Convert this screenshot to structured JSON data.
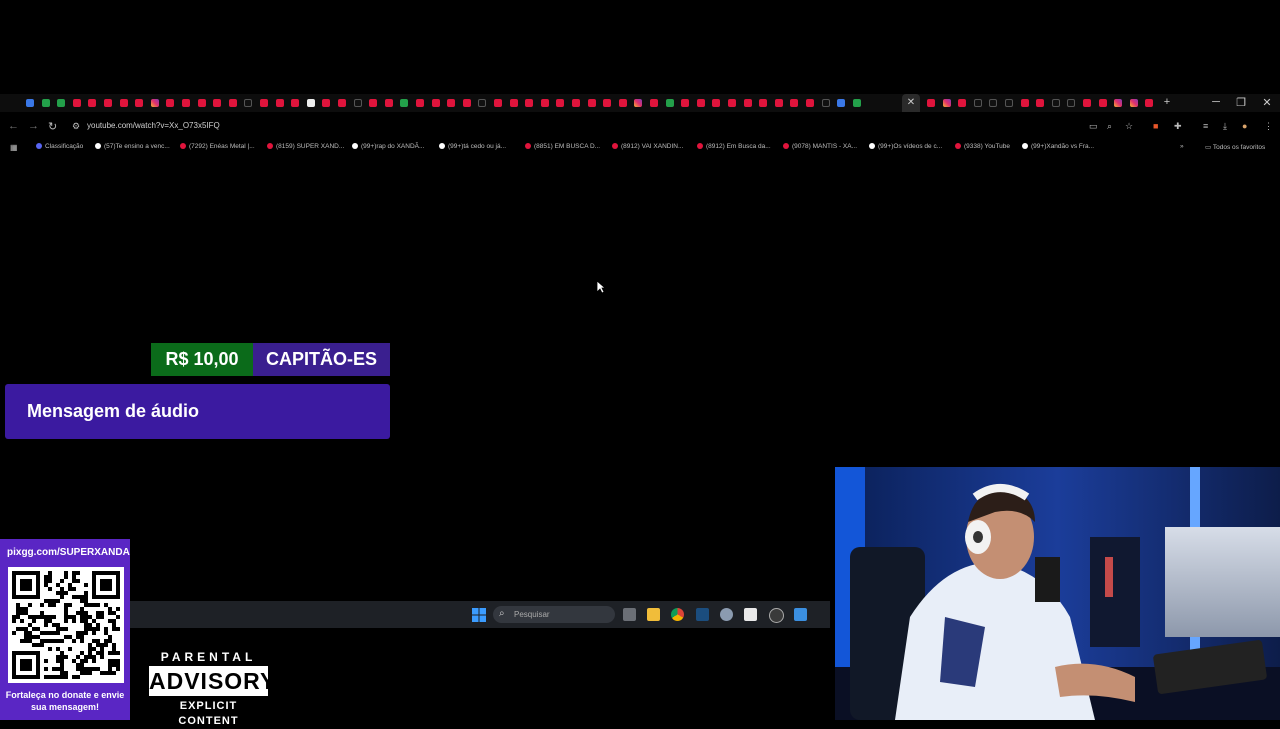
{
  "browser": {
    "url": "youtube.com/watch?v=Xx_O73x5IFQ",
    "bookmarks": [
      {
        "label": "Classificação",
        "icon": "discord-icon",
        "color": "#5865f2"
      },
      {
        "label": "(57)Te ensino a venc...",
        "icon": "tiktok-icon",
        "color": "#ffffff"
      },
      {
        "label": "(7292) Enéas Metal |...",
        "icon": "youtube-icon",
        "color": "#e0143c"
      },
      {
        "label": "(8159) SUPER XAND...",
        "icon": "youtube-icon",
        "color": "#e0143c"
      },
      {
        "label": "(99+)rap do XANDÃ...",
        "icon": "tiktok-icon",
        "color": "#ffffff"
      },
      {
        "label": "(99+)tá cedo ou já...",
        "icon": "tiktok-icon",
        "color": "#ffffff"
      },
      {
        "label": "(8851) EM BUSCA D...",
        "icon": "youtube-icon",
        "color": "#e0143c"
      },
      {
        "label": "(8912) VAI XANDIN...",
        "icon": "youtube-icon",
        "color": "#e0143c"
      },
      {
        "label": "(8912) Em Busca da...",
        "icon": "youtube-icon",
        "color": "#e0143c"
      },
      {
        "label": "(9078) MANTIS - XA...",
        "icon": "youtube-icon",
        "color": "#e0143c"
      },
      {
        "label": "(99+)Os vídeos de c...",
        "icon": "tiktok-icon",
        "color": "#ffffff"
      },
      {
        "label": "(9338) YouTube",
        "icon": "youtube-icon",
        "color": "#e0143c"
      },
      {
        "label": "(99+)Xandão vs Fra...",
        "icon": "tiktok-icon",
        "color": "#ffffff"
      }
    ],
    "all_bookmarks_label": "Todos os favoritos",
    "close_glyph": "✕",
    "new_tab_glyph": "+"
  },
  "alert": {
    "amount": "R$ 10,00",
    "donor": "CAPITÃO-ES",
    "message": "Mensagem de áudio",
    "amount_color": "#0b6b1a",
    "donor_color": "#3a1f8f"
  },
  "taskbar": {
    "search_placeholder": "Pesquisar"
  },
  "pix": {
    "url": "pixgg.com/SUPERXANDAO",
    "caption": "Fortaleça no donate e envie sua mensagem!"
  },
  "parental_advisory": {
    "line1": "PARENTAL",
    "line2": "ADVISORY",
    "line3": "EXPLICIT CONTENT"
  }
}
